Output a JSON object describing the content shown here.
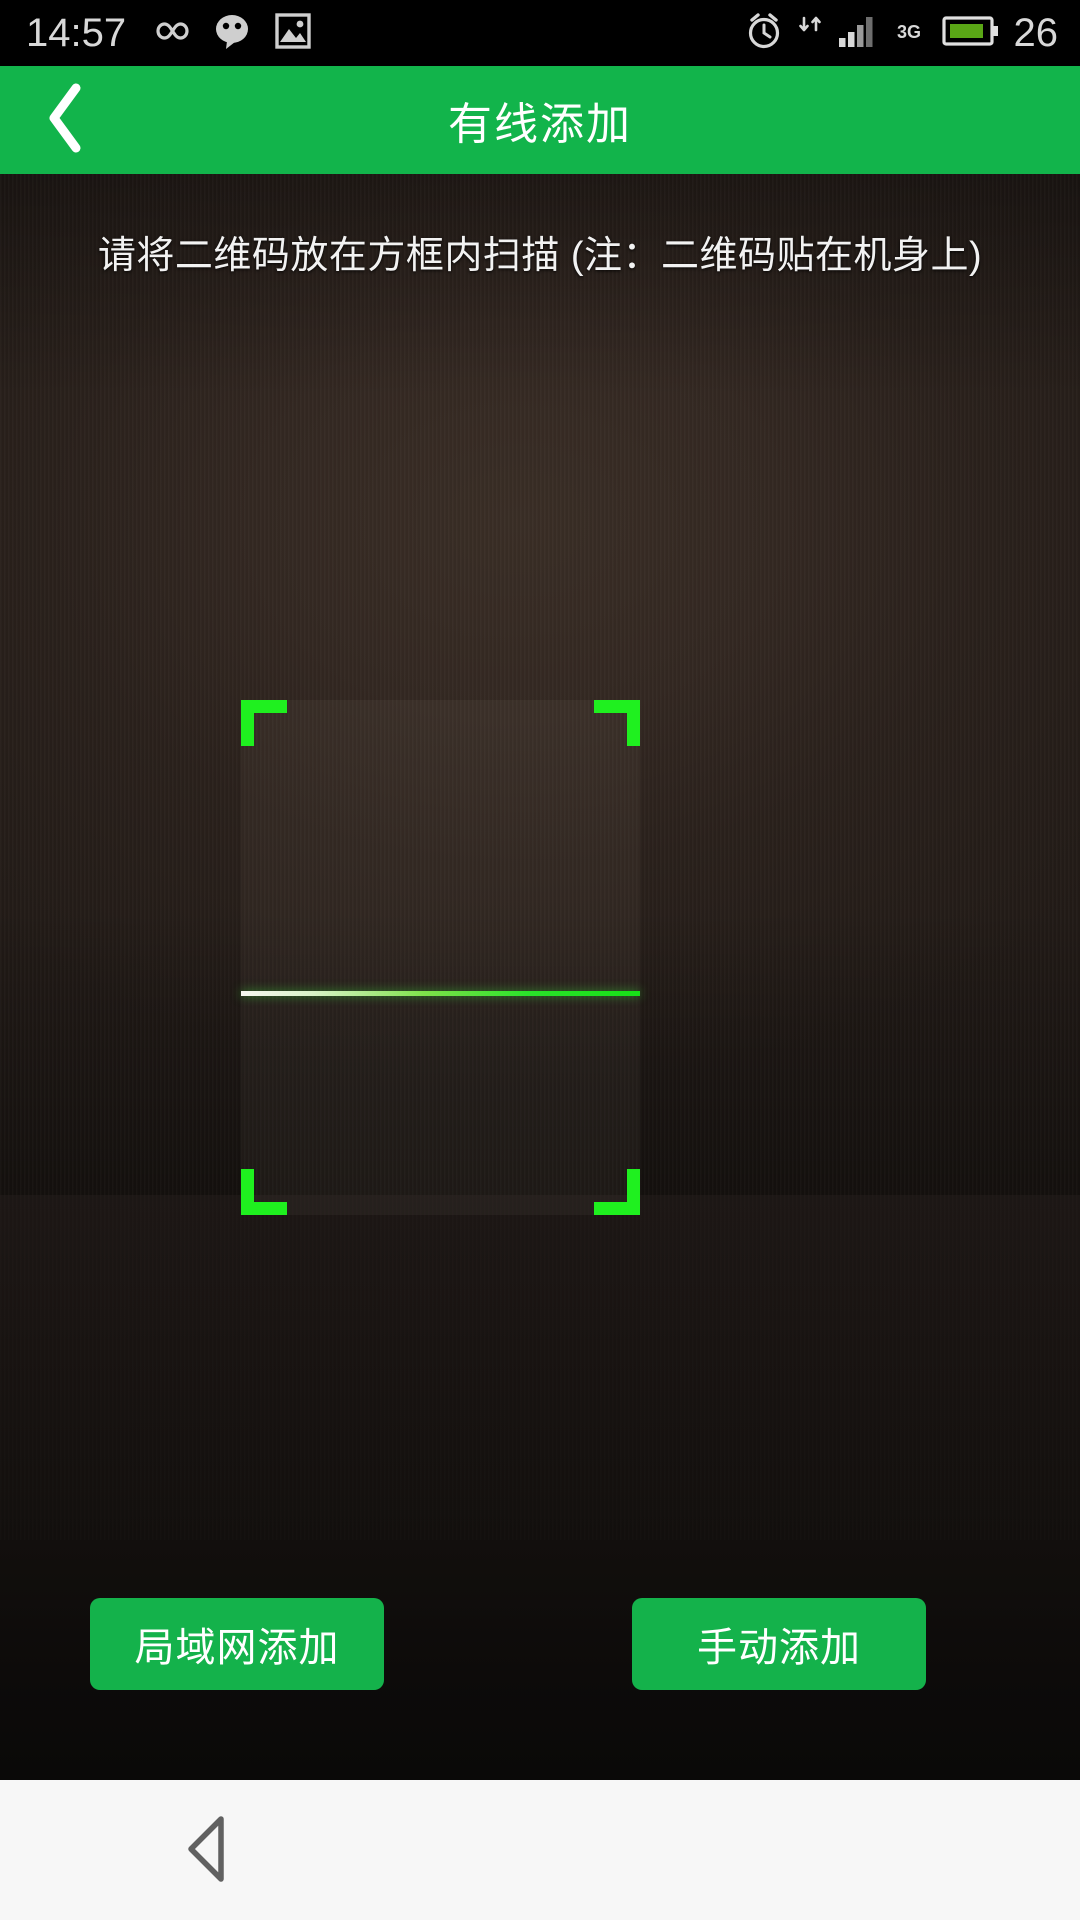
{
  "status_bar": {
    "clock": "14:57",
    "battery_percent": "26",
    "network_type": "3G",
    "icons": [
      "infinity-icon",
      "wechat-bubble-icon",
      "gallery-image-icon",
      "alarm-clock-icon",
      "signal-bars-icon",
      "data-transfer-arrows-icon",
      "battery-icon"
    ],
    "colors": {
      "background": "#000000",
      "text": "#d8d8d8",
      "battery_fill": "#5aa716"
    }
  },
  "header": {
    "title": "有线添加",
    "back_icon": "chevron-left-icon",
    "background_color": "#12b44b",
    "text_color": "#ffffff"
  },
  "scanner": {
    "instruction": "请将二维码放在方框内扫描 (注：二维码贴在机身上)",
    "frame_corner_color": "#1ff01f",
    "scan_line_colors": [
      "#f6f6f0",
      "#17e017"
    ]
  },
  "actions": {
    "lan_add_label": "局域网添加",
    "manual_add_label": "手动添加",
    "button_color": "#14b24b",
    "button_text_color": "#ffffff"
  },
  "nav_bar": {
    "back_icon": "triangle-left-back-icon",
    "background_color": "#f7f7f7",
    "icon_color": "#616161"
  }
}
